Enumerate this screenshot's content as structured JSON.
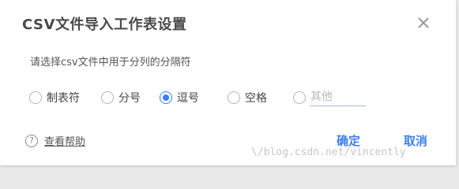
{
  "dialog": {
    "title": "CSV文件导入工作表设置",
    "description": "请选择csv文件中用于分列的分隔符",
    "options": [
      {
        "label": "制表符",
        "checked": false
      },
      {
        "label": "分号",
        "checked": false
      },
      {
        "label": "逗号",
        "checked": true
      },
      {
        "label": "空格",
        "checked": false
      },
      {
        "label": "",
        "checked": false
      }
    ],
    "other_placeholder": "其他",
    "other_value": "",
    "help": {
      "icon_text": "?",
      "label": "查看帮助"
    },
    "buttons": {
      "ok": "确定",
      "cancel": "取消"
    },
    "accent_color": "#3d7ef0"
  },
  "watermark": "\\/blog.csdn.net/vincently"
}
